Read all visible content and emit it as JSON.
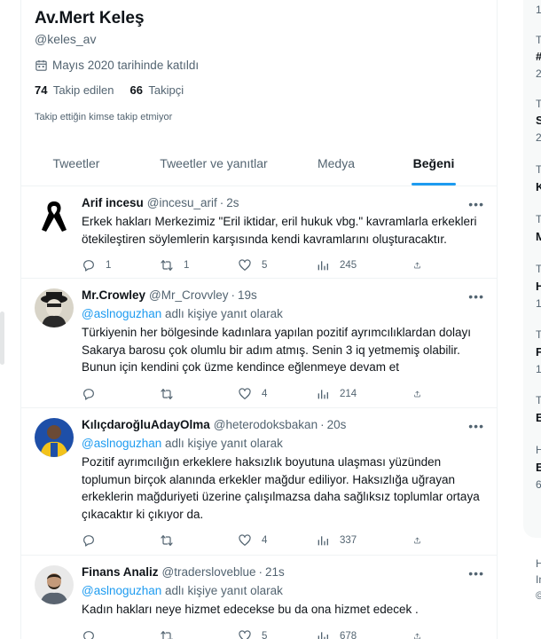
{
  "profile": {
    "display_name": "Av.Mert Keleş",
    "handle": "@keles_av",
    "joined": "Mayıs 2020 tarihinde katıldı",
    "following_count": "74",
    "following_label": "Takip edilen",
    "followers_count": "66",
    "followers_label": "Takipçi",
    "follow_note": "Takip ettiğin kimse takip etmiyor"
  },
  "tabs": [
    {
      "label": "Tweetler",
      "active": false
    },
    {
      "label": "Tweetler ve yanıtlar",
      "active": false
    },
    {
      "label": "Medya",
      "active": false
    },
    {
      "label": "Beğeni",
      "active": true
    }
  ],
  "tweets": [
    {
      "name": "Arif incesu",
      "username": "@incesu_arif",
      "sep": "·",
      "time": "2s",
      "reply_mention": "",
      "reply_suffix": "",
      "text": "Erkek hakları Merkezimiz \"Eril iktidar, eril hukuk vbg.\" kavramlarla erkekleri ötekileştiren söylemlerin karşısında kendi kavramlarını oluşturacaktır.",
      "replies": "1",
      "retweets": "1",
      "likes": "5",
      "views": "245"
    },
    {
      "name": "Mr.Crowley",
      "username": "@Mr_Crovvley",
      "sep": "·",
      "time": "19s",
      "reply_mention": "@aslnoguzhan",
      "reply_suffix": " adlı kişiye yanıt olarak",
      "text": "Türkiyenin her bölgesinde kadınlara yapılan pozitif ayrımcılıklardan dolayı Sakarya barosu çok olumlu bir adım atmış. Senin 3 iq yetmemiş olabilir. Bunun için kendini çok üzme kendince eğlenmeye devam et",
      "replies": "",
      "retweets": "",
      "likes": "4",
      "views": "214"
    },
    {
      "name": "KılıçdaroğluAdayOlma",
      "username": "@heterodoksbakan",
      "sep": "·",
      "time": "20s",
      "reply_mention": "@aslnoguzhan",
      "reply_suffix": " adlı kişiye yanıt olarak",
      "text": "Pozitif ayrımcılığın erkeklere haksızlık boyutuna ulaşması yüzünden toplumun birçok alanında erkekler mağdur ediliyor. Haksızlığa uğrayan erkeklerin mağduriyeti üzerine çalışılmazsa daha sağlıksız toplumlar ortaya çıkacaktır ki çıkıyor da.",
      "replies": "",
      "retweets": "",
      "likes": "4",
      "views": "337"
    },
    {
      "name": "Finans Analiz",
      "username": "@tradersloveblue",
      "sep": "·",
      "time": "21s",
      "reply_mention": "@aslnoguzhan",
      "reply_suffix": " adlı kişiye yanıt olarak",
      "text": "Kadın hakları neye hizmet edecekse bu da ona hizmet edecek .",
      "replies": "",
      "retweets": "",
      "likes": "5",
      "views": "678"
    }
  ],
  "more_glyph": "•••",
  "right_col": [
    {
      "text": "1",
      "bold": false
    },
    {
      "text": "T",
      "bold": false
    },
    {
      "text": "#",
      "bold": true
    },
    {
      "text": "2",
      "bold": false
    },
    {
      "text": "T",
      "bold": false
    },
    {
      "text": "S",
      "bold": true
    },
    {
      "text": "2",
      "bold": false
    },
    {
      "text": "T",
      "bold": false
    },
    {
      "text": "K",
      "bold": true
    },
    {
      "text": "T",
      "bold": false
    },
    {
      "text": "M",
      "bold": true
    },
    {
      "text": "T",
      "bold": false
    },
    {
      "text": "H",
      "bold": true
    },
    {
      "text": "1",
      "bold": false
    },
    {
      "text": "T",
      "bold": false
    },
    {
      "text": "F",
      "bold": true
    },
    {
      "text": "1",
      "bold": false
    },
    {
      "text": "T",
      "bold": false
    },
    {
      "text": "E",
      "bold": true
    },
    {
      "text": "H",
      "bold": false
    },
    {
      "text": "E",
      "bold": true
    },
    {
      "text": "6",
      "bold": false
    },
    {
      "text": "H",
      "bold": false
    },
    {
      "text": "In",
      "bold": false
    },
    {
      "text": "©",
      "bold": false
    }
  ],
  "colors": {
    "accent": "#1d9bf0",
    "text": "#0f1419",
    "muted": "#536471",
    "border": "#eff3f4"
  }
}
